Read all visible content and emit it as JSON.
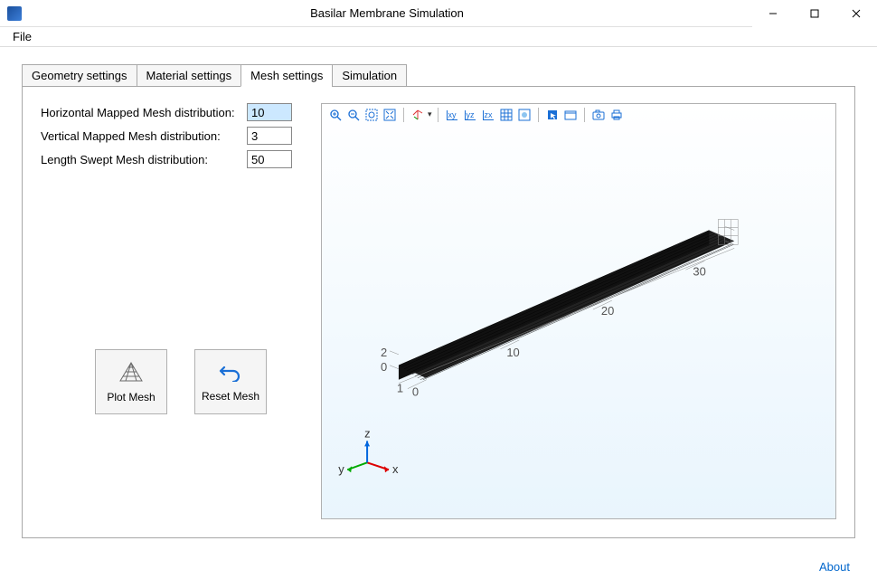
{
  "window": {
    "title": "Basilar Membrane Simulation"
  },
  "menu": {
    "file": "File"
  },
  "tabs": {
    "geometry": "Geometry settings",
    "material": "Material settings",
    "mesh": "Mesh settings",
    "simulation": "Simulation"
  },
  "mesh_panel": {
    "horiz_label": "Horizontal Mapped Mesh distribution:",
    "horiz_value": "10",
    "vert_label": "Vertical Mapped Mesh distribution:",
    "vert_value": "3",
    "length_label": "Length Swept Mesh distribution:",
    "length_value": "50",
    "plot_mesh": "Plot Mesh",
    "reset_mesh": "Reset Mesh"
  },
  "viewer": {
    "axis_labels": {
      "x": "x",
      "y": "y",
      "z": "z"
    },
    "ticks": {
      "0a": "0",
      "0b": "0",
      "1": "1",
      "2": "2",
      "10": "10",
      "20": "20",
      "30": "30"
    }
  },
  "footer": {
    "about": "About"
  }
}
